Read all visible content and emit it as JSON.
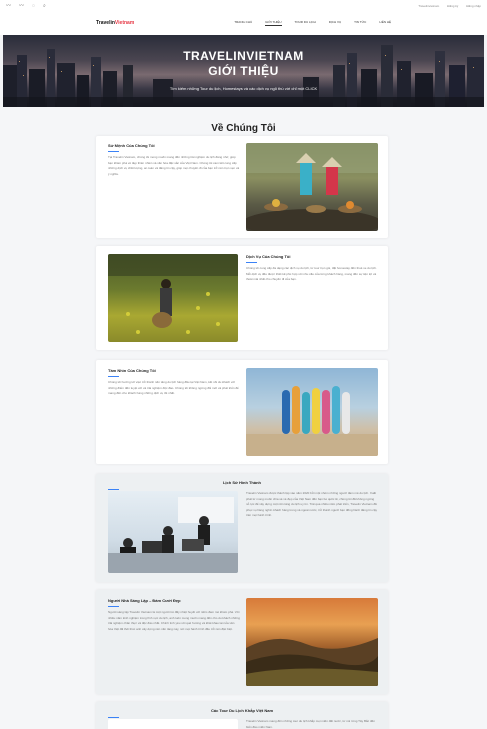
{
  "topbar": {
    "icons": [
      "wave-icon",
      "wave-icon",
      "location-pin-icon",
      "search-icon"
    ],
    "links": [
      "Travelinvietnam",
      "Đăng ký",
      "Đăng nhập"
    ]
  },
  "nav": {
    "logo_a": "Travelin",
    "logo_b": "Vietnam",
    "items": [
      {
        "label": "Trang chủ",
        "active": false
      },
      {
        "label": "Giới thiệu",
        "active": true
      },
      {
        "label": "Tour du lịch",
        "active": false
      },
      {
        "label": "Dịch vụ",
        "active": false
      },
      {
        "label": "Tin tức",
        "active": false
      },
      {
        "label": "Liên hệ",
        "active": false
      }
    ]
  },
  "hero": {
    "title_1": "TRAVELINVIETNAM",
    "title_2": "GIỚI THIỆU",
    "subtitle": "Tìm kiếm những Tour du lịch, Homestays và các dịch vụ ngõ thú vời chỉ một CLICK"
  },
  "about": {
    "heading": "Về Chúng Tôi",
    "mission": {
      "title": "Sứ Mệnh Của Chúng Tôi",
      "text": "Tại Travelin Vietnam, chúng tôi mong muốn mang đến những trải nghiệm du lịch đáng nhớ, giúp bạn khám phá vẻ đẹp thiên nhiên và văn hóa đặc sắc của Việt Nam. Chúng tôi cam kết cung cấp những dịch vụ chất lượng, an toàn và đáng tin cậy, giúp mọi chuyến đi của bạn trở nên trọn vẹn và ý nghĩa."
    },
    "services": {
      "title": "Dịch Vụ Của Chúng Tôi",
      "text": "Chúng tôi cung cấp đa dạng các dịch vụ du lịch, từ tour trọn gói, đặt homestay đến thuê xe du lịch. Mỗi dịch vụ đều được thiết kế phù hợp với nhu cầu của từng khách hàng, mang đến sự tiện lợi và thoải mái nhất cho chuyến đi của bạn."
    },
    "vision": {
      "title": "Tầm Nhìn Của Chúng Tôi",
      "text": "Chúng tôi hướng tới việc trở thành nền tảng du lịch hàng đầu tại Việt Nam, kết nối du khách với những điểm đến tuyệt vời và trải nghiệm độc đáo. Chúng tôi không ngừng đổi mới và phát triển để mang đến cho khách hàng những dịch vụ tốt nhất."
    },
    "history": {
      "title": "Lịch Sử Hình Thành",
      "text": "Travelin Vietnam được thành lập vào năm 2020 bởi một nhóm những người đam mê du lịch. Xuất phát từ mong muốn chia sẻ vẻ đẹp của Việt Nam đến bạn bè quốc tế, chúng tôi đã không ngừng nỗ lực để xây dựng một nền tảng du lịch uy tín. Trải qua nhiều năm phát triển, Travelin Vietnam đã phục vụ hàng nghìn khách hàng trong và ngoài nước, trở thành người bạn đồng hành đáng tin cậy trên mọi hành trình."
    },
    "founder": {
      "title": "Người Nhà Sáng Lập – Đám Cưới Đẹp",
      "text": "Người sáng lập Travelin Vietnam là một người trẻ đầy nhiệt huyết với niềm đam mê khám phá. Với nhiều năm kinh nghiệm trong lĩnh vực du lịch, anh luôn mong muốn mang đến cho du khách những trải nghiệm chân thực và độc đáo nhất. Chính tình yêu với quê hương và khát khao lan tỏa văn hóa Việt đã thôi thúc anh xây dựng nên nền tảng này, nơi mọi hành trình đều trở nên đặc biệt."
    },
    "tours": {
      "title": "Các Tour Du Lịch Khắp Việt Nam",
      "text": "Travelin Vietnam mang đến những tour du lịch khắp mọi miền đất nước, từ núi rừng Tây Bắc đến biển đảo miền Nam."
    }
  }
}
